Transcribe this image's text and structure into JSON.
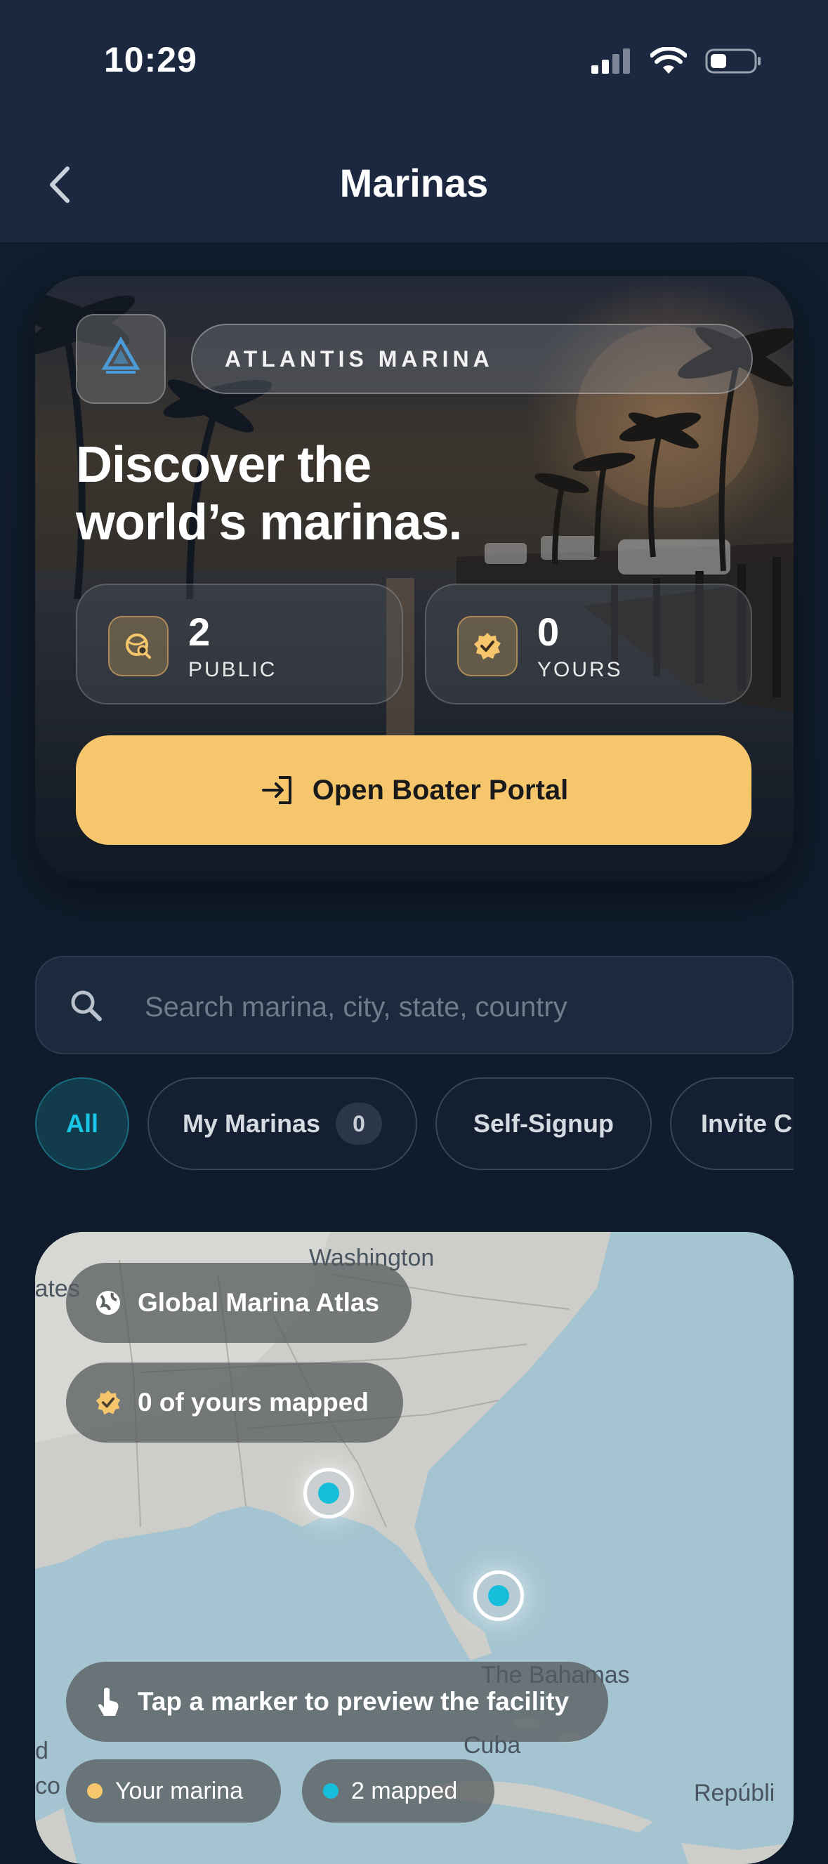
{
  "status_bar": {
    "time": "10:29"
  },
  "header": {
    "title": "Marinas"
  },
  "hero": {
    "logo_text": "ATLANTIS MARINA",
    "badge": "ATLANTIS MARINA",
    "headline_line1": "Discover the",
    "headline_line2": "world’s marinas.",
    "stats": [
      {
        "value": "2",
        "label": "PUBLIC",
        "icon": "globe-search-icon"
      },
      {
        "value": "0",
        "label": "YOURS",
        "icon": "verified-badge-icon"
      }
    ],
    "portal_button": "Open Boater Portal"
  },
  "search": {
    "placeholder": "Search marina, city, state, country"
  },
  "filters": [
    {
      "label": "All",
      "active": true
    },
    {
      "label": "My Marinas",
      "count": "0"
    },
    {
      "label": "Self-Signup"
    },
    {
      "label": "Invite C"
    }
  ],
  "map": {
    "labels": {
      "washington": "Washington",
      "states": "tates",
      "bahamas": "The Bahamas",
      "cuba": "Cuba",
      "left_d": "d",
      "left_co": "co",
      "republic": "Repúbli"
    },
    "atlas_pill": "Global Marina Atlas",
    "mapped_pill": "0 of yours mapped",
    "hint_pill": "Tap a marker to preview the facility",
    "legend": [
      {
        "label": "Your marina",
        "color": "#f6c66c"
      },
      {
        "label": "2 mapped",
        "color": "#17bedc"
      }
    ]
  },
  "colors": {
    "accent": "#f6c66c",
    "teal": "#17bedc",
    "header": "#1b2840",
    "background": "#0f1b2b"
  }
}
